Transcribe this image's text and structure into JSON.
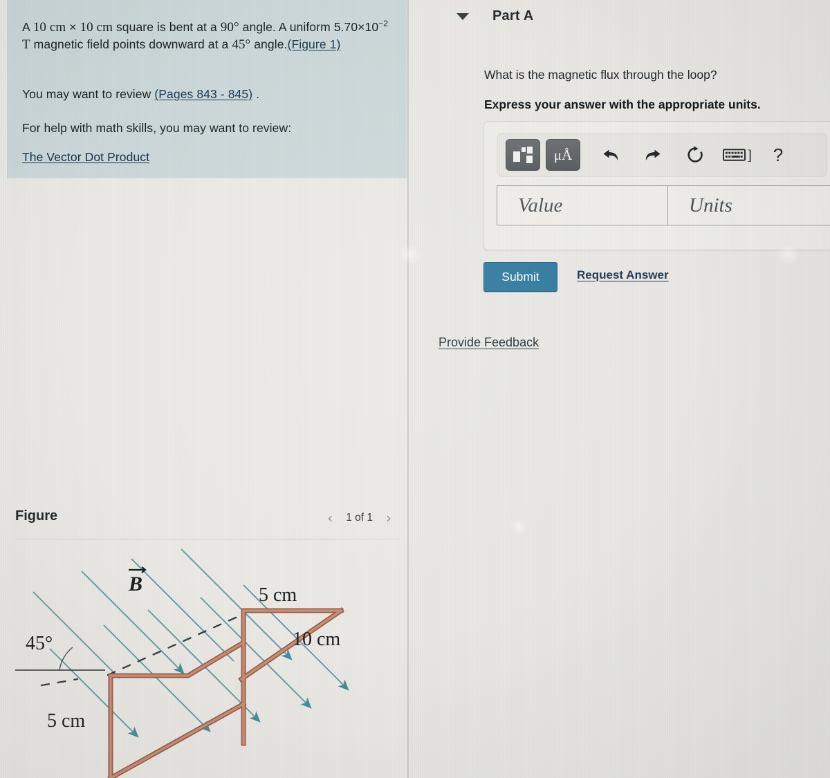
{
  "problem": {
    "line1_a": "A ",
    "line1_m1": "10 cm",
    "line1_b": " × ",
    "line1_m2": "10 cm",
    "line1_c": " square is bent at a ",
    "line1_m3": "90°",
    "line1_d": " angle. A uniform 5.70×10",
    "line1_exp": "−2",
    "line1_e": " ",
    "line1_m4": "T",
    "line1_f": " magnetic field points downward at a ",
    "line1_m5": "45°",
    "line1_g": " angle.",
    "figure_link": "(Figure 1)",
    "review_prefix": "You may want to review ",
    "pages_link": "(Pages 843 - 845)",
    "review_suffix": " .",
    "math_skills": "For help with math skills, you may want to review:",
    "dot_product_link": "The Vector Dot Product"
  },
  "figure": {
    "title": "Figure",
    "prev_icon": "chevron-left-icon",
    "next_icon": "chevron-right-icon",
    "count": "1 of 1",
    "diagram": {
      "field_label": "B",
      "angle_label": "45°",
      "top_length": "5 cm",
      "depth_length": "10 cm",
      "side_length": "5 cm",
      "loop_color": "#b5775f",
      "field_color": "#3e8a96"
    }
  },
  "part": {
    "caret_icon": "caret-down-icon",
    "title": "Part A",
    "question": "What is the magnetic flux through the loop?",
    "instruction": "Express your answer with the appropriate units.",
    "toolbar": {
      "template_icon": "math-template-icon",
      "units_icon": "μÅ",
      "undo_icon": "undo-arrow-icon",
      "redo_icon": "redo-arrow-icon",
      "reset_icon": "reset-circular-arrow-icon",
      "keyboard_icon": "keyboard-icon",
      "bracket": "]",
      "help": "?"
    },
    "value_placeholder": "Value",
    "units_placeholder": "Units",
    "submit_label": "Submit",
    "request_answer_label": "Request Answer",
    "provide_feedback_label": "Provide Feedback",
    "accent_color": "#2f7b9e"
  }
}
